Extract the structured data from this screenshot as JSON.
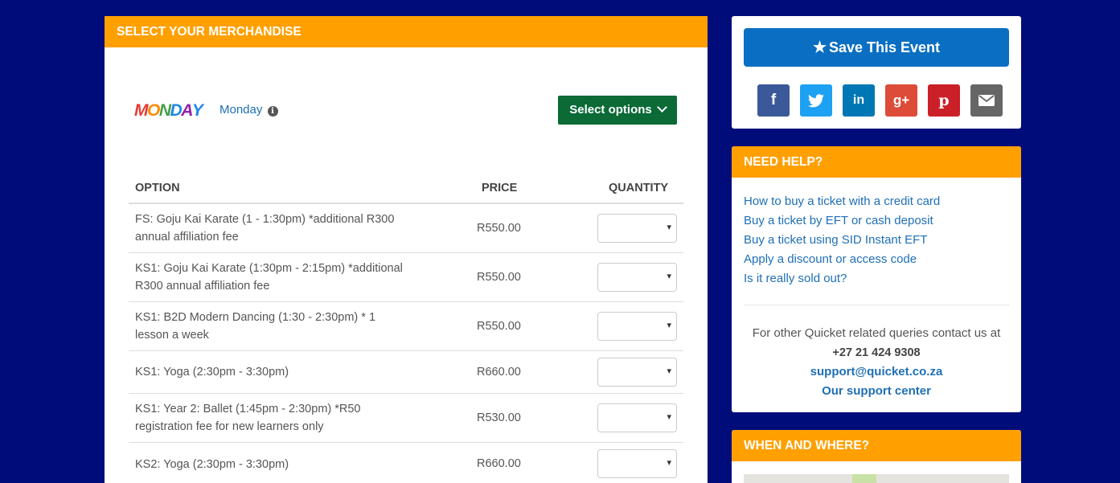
{
  "merch": {
    "header": "SELECT YOUR MERCHANDISE",
    "product": {
      "logo_text": "MONDAY",
      "logo_colors": [
        "#e53935",
        "#fb8c00",
        "#43a047",
        "#1e88e5",
        "#8e24aa",
        "#fdd835"
      ],
      "name": "Monday",
      "info_icon": "info-circle-icon",
      "select_label": "Select options"
    },
    "table": {
      "headers": {
        "option": "OPTION",
        "price": "PRICE",
        "quantity": "QUANTITY"
      },
      "rows": [
        {
          "option": "FS: Goju Kai Karate (1 - 1:30pm) *additional R300 annual affiliation fee",
          "price": "R550.00"
        },
        {
          "option": "KS1: Goju Kai Karate (1:30pm - 2:15pm) *additional R300 annual affiliation fee",
          "price": "R550.00"
        },
        {
          "option": "KS1: B2D Modern Dancing (1:30 - 2:30pm) * 1 lesson a week",
          "price": "R550.00"
        },
        {
          "option": "KS1: Yoga (2:30pm - 3:30pm)",
          "price": "R660.00"
        },
        {
          "option": "KS1: Year 2: Ballet (1:45pm - 2:30pm) *R50 registration fee for new learners only",
          "price": "R530.00"
        },
        {
          "option": "KS2: Yoga (2:30pm - 3:30pm)",
          "price": "R660.00"
        }
      ]
    }
  },
  "save": {
    "label": "Save This Event",
    "icon": "star-icon"
  },
  "social": [
    {
      "name": "facebook",
      "glyph": "f",
      "color": "#3b5998"
    },
    {
      "name": "twitter",
      "glyph": "t",
      "color": "#1da1f2"
    },
    {
      "name": "linkedin",
      "glyph": "in",
      "color": "#0077b5"
    },
    {
      "name": "google-plus",
      "glyph": "g+",
      "color": "#dd4b39"
    },
    {
      "name": "pinterest",
      "glyph": "p",
      "color": "#cb2027"
    },
    {
      "name": "email",
      "glyph": "✉",
      "color": "#666666"
    }
  ],
  "help": {
    "header": "NEED HELP?",
    "links": [
      "How to buy a ticket with a credit card",
      "Buy a ticket by EFT or cash deposit",
      "Buy a ticket using SID Instant EFT",
      "Apply a discount or access code",
      "Is it really sold out?"
    ],
    "contact_text": "For other Quicket related queries contact us at",
    "phone": "+27 21 424 9308",
    "email": "support@quicket.co.za",
    "support_center": "Our support center"
  },
  "where": {
    "header": "WHEN AND WHERE?"
  },
  "colors": {
    "background": "#000c7a",
    "header_orange": "#ffa000",
    "select_green": "#0b6a36",
    "save_blue": "#0a6fc2",
    "link_blue": "#1f6fb5"
  }
}
